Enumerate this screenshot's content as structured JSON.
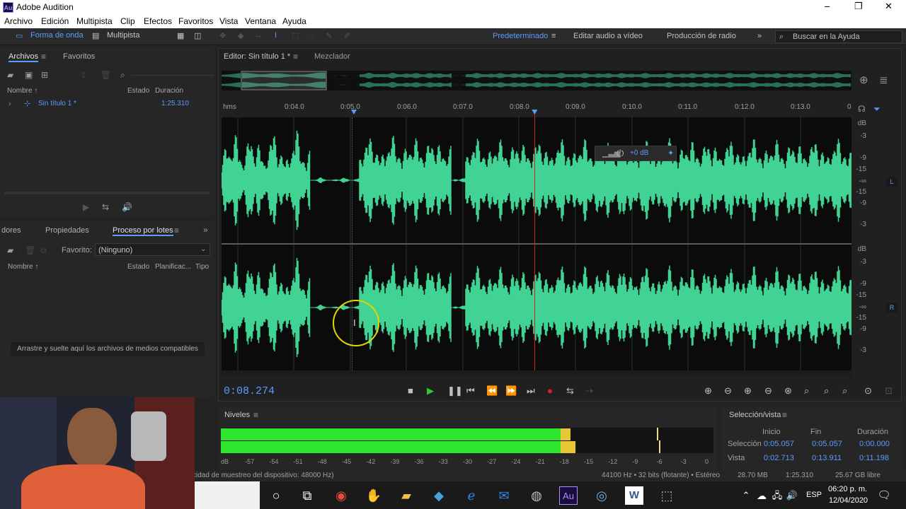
{
  "window": {
    "app_badge": "Au",
    "title": "Adobe Audition",
    "minimize": "–",
    "maximize": "❐",
    "close": "✕"
  },
  "menu": [
    "Archivo",
    "Edición",
    "Multipista",
    "Clip",
    "Efectos",
    "Favoritos",
    "Vista",
    "Ventana",
    "Ayuda"
  ],
  "toolbar": {
    "waveform_label": "Forma de onda",
    "multitrack_label": "Multipista",
    "workspaces": [
      "Predeterminado",
      "Editar audio a vídeo",
      "Producción de radio"
    ],
    "search_placeholder": "Buscar en la Ayuda"
  },
  "files_panel": {
    "tabs": [
      "Archivos",
      "Favoritos"
    ],
    "columns": [
      "Nombre ↑",
      "Estado",
      "Duración"
    ],
    "rows": [
      {
        "name": "Sin título 1 *",
        "duration": "1:25.310"
      }
    ]
  },
  "batch_panel": {
    "tabs": [
      "dores",
      "Propiedades",
      "Proceso por lotes"
    ],
    "favorite_label": "Favorito:",
    "favorite_value": "(Ninguno)",
    "columns": [
      "Nombre ↑",
      "Estado",
      "Planificac...",
      "Tipo"
    ],
    "drop_hint": "Arrastre y suelte aquí los archivos de medios compatibles"
  },
  "editor": {
    "tab_label": "Editor: Sin título 1 *",
    "mixer_label": "Mezclador",
    "ruler": [
      "hms",
      "0:04.0",
      "0:05.0",
      "0:06.0",
      "0:07.0",
      "0:08.0",
      "0:09.0",
      "0:10.0",
      "0:11.0",
      "0:12.0",
      "0:13.0",
      "0"
    ],
    "db_labels_top": [
      "dB",
      "-3",
      "-9",
      "-15",
      "-∞",
      "-15",
      "-9",
      "-3"
    ],
    "db_labels_bottom": [
      "dB",
      "-3",
      "-9",
      "-15",
      "-∞",
      "-15",
      "-9",
      "-3"
    ],
    "channel_left": "L",
    "channel_right": "R",
    "hud_gain": "+0 dB",
    "timecode": "0:08.274",
    "playhead_fraction": 0.497
  },
  "levels": {
    "title": "Niveles",
    "scale": [
      "dB",
      "-57",
      "-54",
      "-51",
      "-48",
      "-45",
      "-42",
      "-39",
      "-36",
      "-33",
      "-30",
      "-27",
      "-24",
      "-21",
      "-18",
      "-15",
      "-12",
      "-9",
      "-6",
      "-3",
      "0"
    ],
    "left_level_percent": 71,
    "right_level_percent": 72
  },
  "selection": {
    "title": "Selección/vista",
    "headers": [
      "Inicio",
      "Fin",
      "Duración"
    ],
    "rows": [
      {
        "label": "Selección",
        "start": "0:05.057",
        "end": "0:05.057",
        "duration": "0:00.000"
      },
      {
        "label": "Vista",
        "start": "0:02.713",
        "end": "0:13.911",
        "duration": "0:11.198"
      }
    ]
  },
  "status": {
    "left": "cidad de muestreo del dispositivo: 48000 Hz)",
    "format": "44100 Hz • 32 bits (flotante) • Estéreo",
    "size": "28.70 MB",
    "duration": "1:25.310",
    "free": "25.67 GB libre"
  },
  "taskbar": {
    "lang": "ESP",
    "time": "06:20 p. m.",
    "date": "12/04/2020"
  },
  "colors": {
    "accent": "#5c9bff",
    "waveform": "#41d394",
    "meter_green": "#2ee62e",
    "meter_yellow": "#e8c532",
    "playhead": "#d02020"
  }
}
